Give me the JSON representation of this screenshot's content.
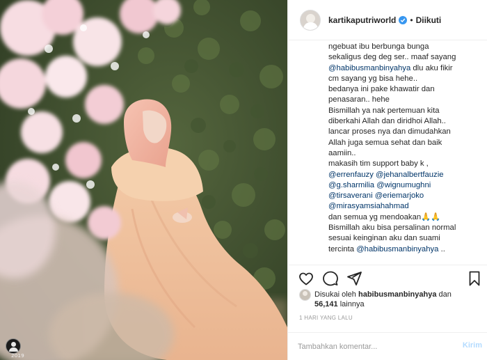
{
  "post": {
    "username": "kartikaputriworld",
    "verified": true,
    "separator": "•",
    "follow_label": "Diikuti",
    "photo_caption": "2019"
  },
  "caption": [
    {
      "text": "ngebuat ibu berbunga bunga",
      "mention": false
    },
    {
      "text": "sekaligus deg deg ser.. maaf sayang",
      "mention": false
    },
    {
      "text": "@habibusmanbinyahya dlu aku fikir",
      "parts": [
        {
          "t": "@habibusmanbinyahya",
          "m": true
        },
        {
          "t": " dlu aku fikir",
          "m": false
        }
      ]
    },
    {
      "text": "cm sayang yg bisa hehe..",
      "mention": false
    },
    {
      "text": "bedanya ini pake khawatir dan",
      "mention": false
    },
    {
      "text": "penasaran.. hehe",
      "mention": false
    },
    {
      "text": "Bismillah ya nak pertemuan kita",
      "mention": false
    },
    {
      "text": "diberkahi Allah dan diridhoi Allah..",
      "mention": false
    },
    {
      "text": "lancar proses nya dan dimudahkan",
      "mention": false
    },
    {
      "text": "Allah juga semua sehat dan baik",
      "mention": false
    },
    {
      "text": "aamiin..",
      "mention": false
    },
    {
      "text": "makasih tim support baby k ,",
      "mention": false
    },
    {
      "text": "@errenfauzy @jehanalbertfauzie",
      "mention": true
    },
    {
      "text": "@g.sharmilia @wignumughni",
      "mention": true
    },
    {
      "text": "@tirsaverani @eriemarjoko",
      "mention": true
    },
    {
      "text": "@mirasyamsiahahmad",
      "mention": true
    },
    {
      "text": "dan semua yg mendoakan🙏🙏",
      "mention": false
    },
    {
      "text": "Bismillah aku bisa persalinan normal",
      "mention": false
    },
    {
      "text": "sesuai keinginan aku dan suami",
      "mention": false
    },
    {
      "text": "tercinta @habibusmanbinyahya ..",
      "parts": [
        {
          "t": "tercinta ",
          "m": false
        },
        {
          "t": "@habibusmanbinyahya",
          "m": true
        },
        {
          "t": " ..",
          "m": false
        }
      ]
    }
  ],
  "actions": {
    "like_icon": "heart-icon",
    "comment_icon": "comment-bubble-icon",
    "share_icon": "paper-plane-icon",
    "save_icon": "bookmark-icon"
  },
  "likes": {
    "prefix": "Disukai oleh ",
    "user": "habibusmanbinyahya",
    "middle": " dan",
    "count": "56,141",
    "suffix": " lainnya"
  },
  "timestamp": "1 HARI YANG LALU",
  "comment_box": {
    "placeholder": "Tambahkan komentar...",
    "post_label": "Kirim"
  },
  "colors": {
    "link": "#003569",
    "verified": "#3897f0",
    "post_disabled": "#b3dbff",
    "border": "#efefef"
  }
}
